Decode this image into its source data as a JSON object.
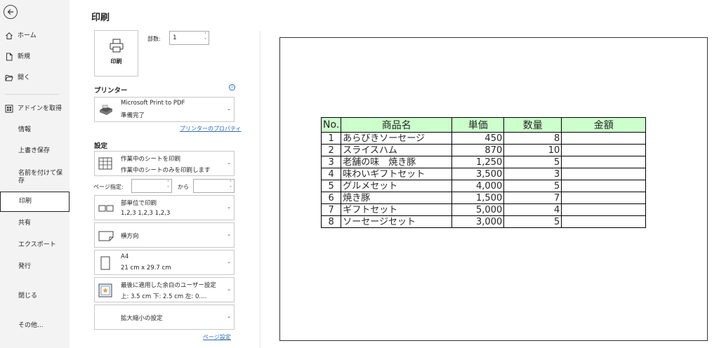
{
  "nav": {
    "items": [
      {
        "label": "ホーム",
        "icon": "home-icon"
      },
      {
        "label": "新規",
        "icon": "new-file-icon"
      },
      {
        "label": "開く",
        "icon": "folder-open-icon"
      },
      {
        "label": "アドインを取得",
        "icon": "addins-icon"
      },
      {
        "label": "情報"
      },
      {
        "label": "上書き保存"
      },
      {
        "label": "名前を付けて保存"
      },
      {
        "label": "印刷"
      },
      {
        "label": "共有"
      },
      {
        "label": "エクスポート"
      },
      {
        "label": "発行"
      },
      {
        "label": "閉じる"
      },
      {
        "label": "その他..."
      }
    ],
    "active": "印刷"
  },
  "panel": {
    "title": "印刷",
    "print_button": "印刷",
    "copies_label": "部数:",
    "copies_value": "1",
    "printer_section": "プリンター",
    "printer_name": "Microsoft Print to PDF",
    "printer_status": "準備完了",
    "printer_properties_link": "プリンターのプロパティ",
    "settings_section": "設定",
    "settings": {
      "scope_main": "作業中のシートを印刷",
      "scope_sub": "作業中のシートのみを印刷します",
      "pages_label": "ページ指定:",
      "pages_from": "",
      "pages_to_label": "から",
      "pages_to": "",
      "collate_main": "部単位で印刷",
      "collate_sub": "1,2,3    1,2,3    1,2,3",
      "orientation": "横方向",
      "paper_main": "A4",
      "paper_sub": "21 cm x 29.7 cm",
      "margins_main": "最後に適用した余白のユーザー設定",
      "margins_sub": "上: 3.5 cm 下: 2.5 cm 左: 0.…",
      "scaling": "拡大縮小の設定"
    },
    "page_setup_link": "ページ設定"
  },
  "preview": {
    "headers": [
      "No.",
      "商品名",
      "単価",
      "数量",
      "金額"
    ],
    "rows": [
      [
        "1",
        "あらびきソーセージ",
        "450",
        "8",
        ""
      ],
      [
        "2",
        "スライスハム",
        "870",
        "10",
        ""
      ],
      [
        "3",
        "老舗の味　焼き豚",
        "1,250",
        "5",
        ""
      ],
      [
        "4",
        "味わいギフトセット",
        "3,500",
        "3",
        ""
      ],
      [
        "5",
        "グルメセット",
        "4,000",
        "5",
        ""
      ],
      [
        "6",
        "焼き豚",
        "1,500",
        "7",
        ""
      ],
      [
        "7",
        "ギフトセット",
        "5,000",
        "4",
        ""
      ],
      [
        "8",
        "ソーセージセット",
        "3,000",
        "5",
        ""
      ]
    ],
    "header_color": "#ccffcc"
  }
}
